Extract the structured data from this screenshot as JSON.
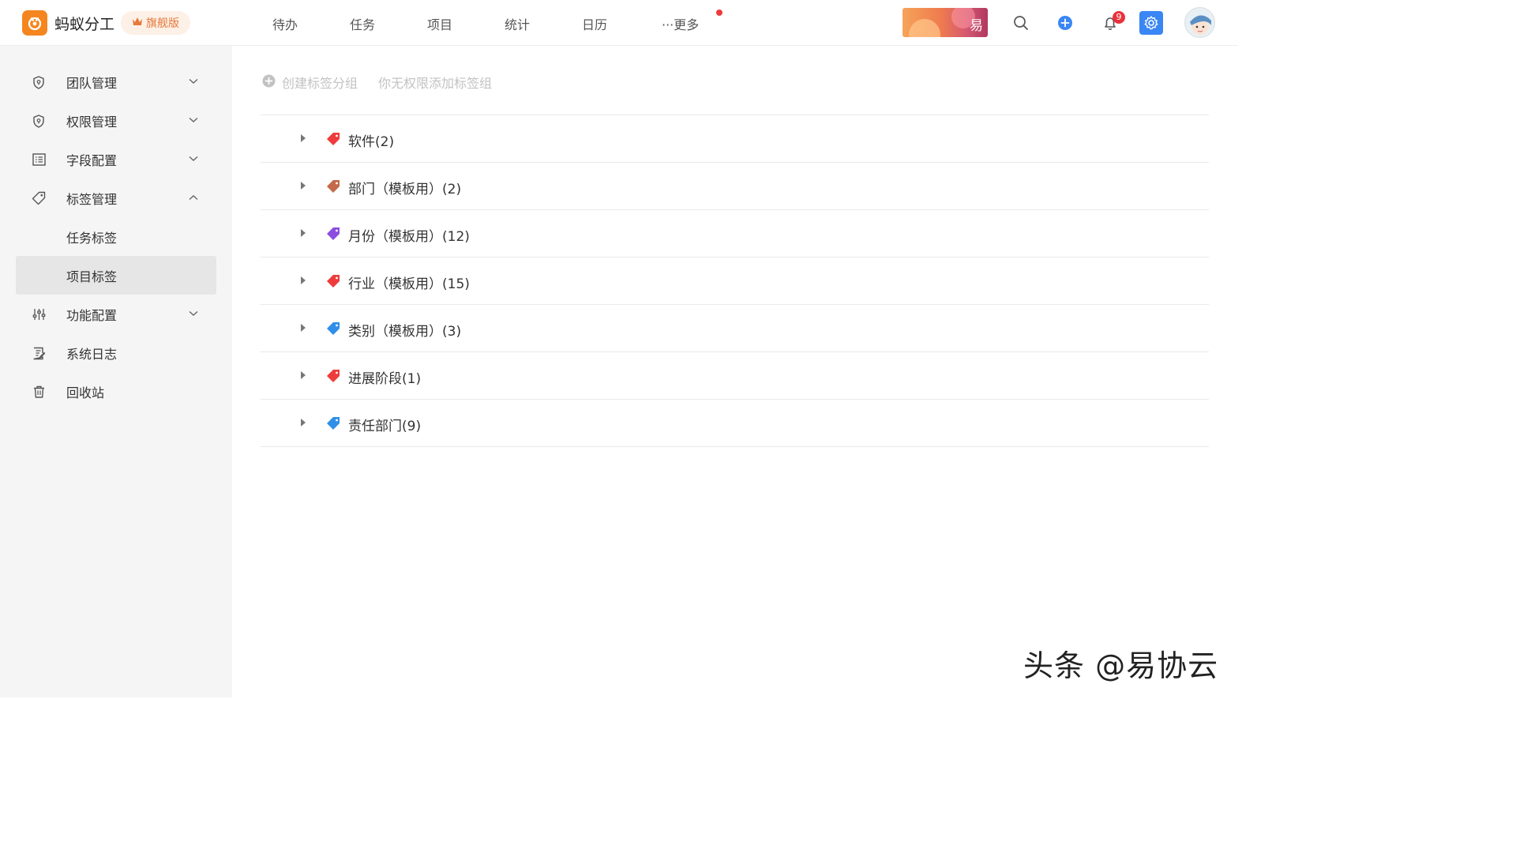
{
  "app": {
    "name": "蚂蚁分工",
    "edition": "旗舰版",
    "brand_color": "#f5861f"
  },
  "nav": {
    "items": [
      "待办",
      "任务",
      "项目",
      "统计",
      "日历"
    ],
    "more_label": "···更多"
  },
  "header": {
    "banner_text": "易",
    "notification_count": "9",
    "accent_color": "#3a86f4"
  },
  "sidebar": {
    "items": [
      {
        "label": "团队管理",
        "icon": "shield-icon",
        "expandable": true
      },
      {
        "label": "权限管理",
        "icon": "shield-icon",
        "expandable": true
      },
      {
        "label": "字段配置",
        "icon": "list-icon",
        "expandable": true
      },
      {
        "label": "标签管理",
        "icon": "tag-icon",
        "expandable": true,
        "expanded": true
      },
      {
        "label": "任务标签",
        "sub": true
      },
      {
        "label": "项目标签",
        "sub": true,
        "active": true
      },
      {
        "label": "功能配置",
        "icon": "sliders-icon",
        "expandable": true
      },
      {
        "label": "系统日志",
        "icon": "log-icon"
      },
      {
        "label": "回收站",
        "icon": "trash-icon"
      }
    ]
  },
  "toolbar": {
    "create_label": "创建标签分组",
    "no_permission_tip": "你无权限添加标签组"
  },
  "tag_groups": [
    {
      "label": "软件(2)",
      "color": "#ee3b3b"
    },
    {
      "label": "部门（模板用）(2)",
      "color": "#c46a4a"
    },
    {
      "label": "月份（模板用）(12)",
      "color": "#8b4de0"
    },
    {
      "label": "行业（模板用）(15)",
      "color": "#ee3b3b"
    },
    {
      "label": "类别（模板用）(3)",
      "color": "#2f8fe8"
    },
    {
      "label": "进展阶段(1)",
      "color": "#ee3b3b"
    },
    {
      "label": "责任部门(9)",
      "color": "#2f8fe8"
    }
  ],
  "watermark": "头条 @易协云"
}
